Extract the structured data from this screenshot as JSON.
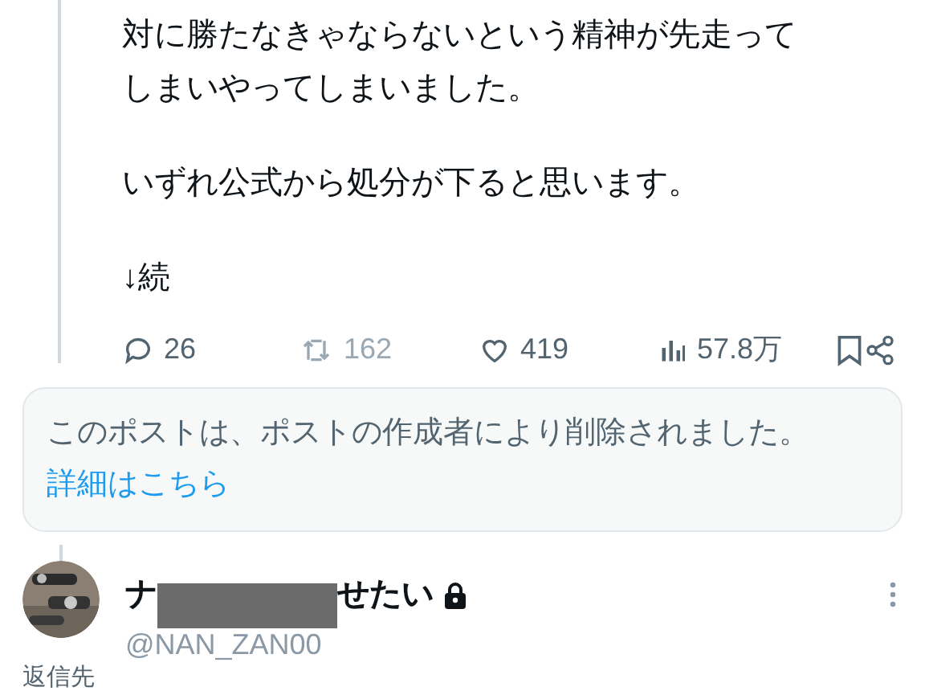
{
  "post": {
    "paragraphs": [
      {
        "lines": [
          "対に勝たなきゃならないという精神が先走って",
          "しまいやってしまいました。"
        ]
      },
      {
        "lines": [
          "いずれ公式から処分が下ると思います。"
        ]
      },
      {
        "lines": [
          "↓続"
        ]
      }
    ],
    "actions": [
      {
        "kind": "reply",
        "count": "26",
        "disabled": false
      },
      {
        "kind": "repost",
        "count": "162",
        "disabled": true
      },
      {
        "kind": "like",
        "count": "419",
        "disabled": false
      },
      {
        "kind": "views",
        "count": "57.8万",
        "disabled": false
      },
      {
        "kind": "bookmark",
        "disabled": false
      },
      {
        "kind": "share",
        "disabled": false
      }
    ]
  },
  "deleted_notice": {
    "text": "このポストは、ポストの作成者により削除されました。",
    "link": "詳細はこちら"
  },
  "reply": {
    "name_start": "ナ",
    "name_end": "せたい",
    "protected": true,
    "handle": "@NAN_ZAN00",
    "reply_to_label": "返信先"
  }
}
